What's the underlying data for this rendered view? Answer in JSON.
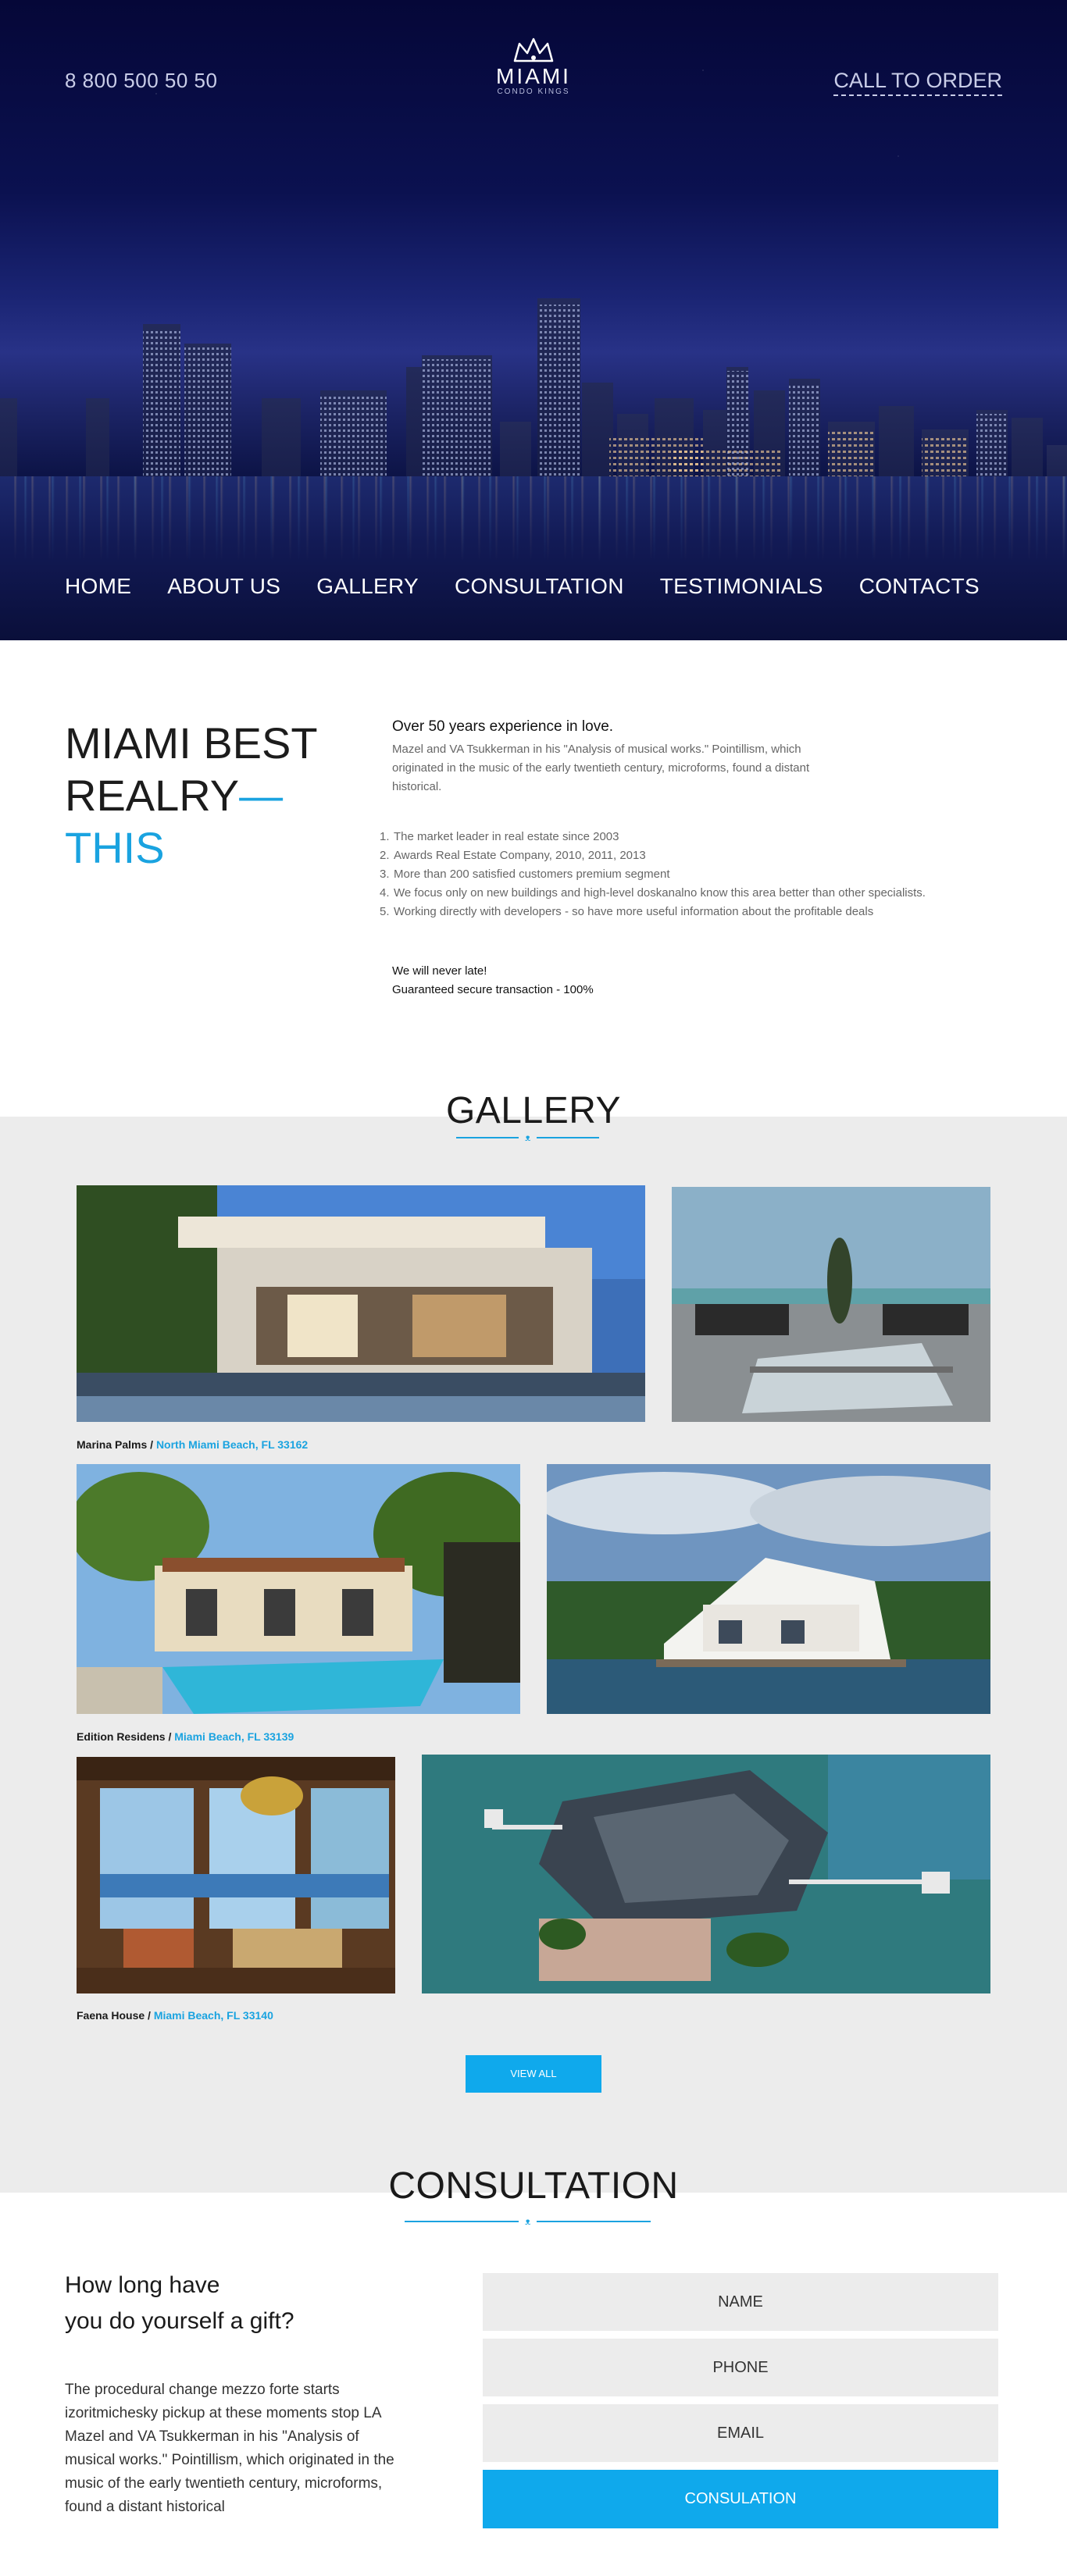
{
  "header": {
    "phone": "8 800 500 50 50",
    "cta": "CALL TO ORDER",
    "logo": {
      "brand": "MIAMI",
      "tagline": "CONDO KINGS"
    }
  },
  "nav": {
    "items": [
      {
        "label": "HOME"
      },
      {
        "label": "ABOUT US"
      },
      {
        "label": "GALLERY"
      },
      {
        "label": "CONSULTATION"
      },
      {
        "label": "TESTIMONIALS"
      },
      {
        "label": "CONTACTS"
      }
    ]
  },
  "about": {
    "title_line1_light": "MIAMI ",
    "title_line1_bold": "BEST",
    "title_line2": "REALRY",
    "title_line2_dash": "—",
    "title_line3": "THIS",
    "heading": "Over 50 years experience in love.",
    "lead": "Mazel and VA Tsukkerman in his \"Analysis of musical works.\" Pointillism, which originated in the music of the early twentieth century, microforms, found a distant historical.",
    "list": [
      {
        "num": "1.",
        "text": "The market leader in real estate since 2003"
      },
      {
        "num": "2.",
        "text": "Awards Real Estate Company, 2010, 2011, 2013"
      },
      {
        "num": "3.",
        "text": "More than 200 satisfied customers premium segment"
      },
      {
        "num": "4.",
        "text": "We focus only on new buildings and high-level doskanalno know this area better than other specialists."
      },
      {
        "num": "5.",
        "text": "Working directly with developers - so have more useful information about the profitable deals"
      }
    ],
    "footer_line1": "We will never late!",
    "footer_line2": "Guaranteed secure transaction - 100%"
  },
  "gallery": {
    "title": "GALLERY",
    "ornament": "ᴥ",
    "captions": [
      {
        "name": "Marina Palms",
        "sep": " / ",
        "address": "North Miami Beach, FL 33162"
      },
      {
        "name": "Edition Residens",
        "sep": " / ",
        "address": "Miami Beach, FL 33139"
      },
      {
        "name": "Faena House",
        "sep": " / ",
        "address": "Miami Beach, FL 33140"
      }
    ],
    "view_all": "VIEW ALL"
  },
  "consultation": {
    "title": "CONSULTATION",
    "heading_line1": "How long have",
    "heading_line2": "you do yourself a gift?",
    "text": "The procedural change mezzo forte starts izoritmichesky pickup at these moments stop LA Mazel and VA Tsukkerman in his \"Analysis of musical works.\" Pointillism, which originated in the music of the early twentieth century, microforms, found a distant historical",
    "name_placeholder": "NAME",
    "phone_placeholder": "PHONE",
    "email_placeholder": "EMAIL",
    "submit_label": "CONSULATION"
  },
  "colors": {
    "accent": "#0fa9ec",
    "hero_dark": "#0a0f3a",
    "gallery_bg": "#ececec"
  }
}
